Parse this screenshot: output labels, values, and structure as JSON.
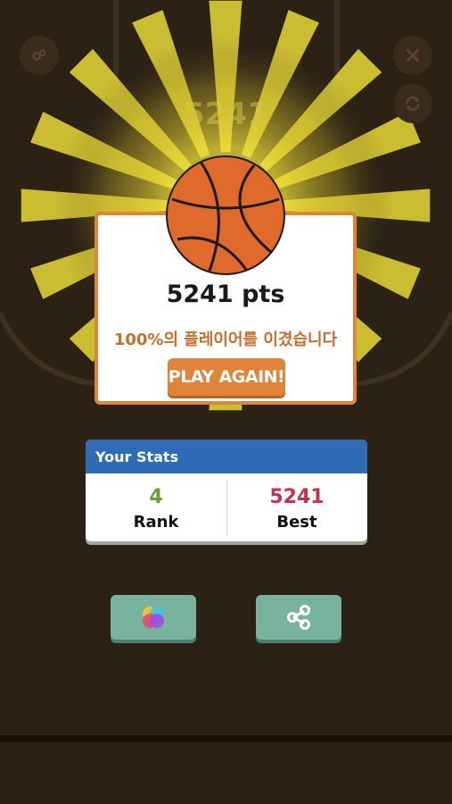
{
  "game": {
    "score_text": "5241 pts",
    "ghost_score": "5241",
    "beat_text": "100%의 플레이어를 이겼습니다",
    "play_again_label": "PLAY AGAIN!"
  },
  "stats": {
    "header": "Your Stats",
    "rank": {
      "value": "4",
      "label": "Rank",
      "color": "#6f9a34"
    },
    "best": {
      "value": "5241",
      "label": "Best",
      "color": "#c8304f"
    }
  },
  "icons": {
    "top_left": "settings-icon",
    "top_right_1": "close-icon",
    "top_right_2": "refresh-icon",
    "bottom_left": "game-center-icon",
    "bottom_right": "share-icon"
  },
  "colors": {
    "background": "#2b2115",
    "accent": "#e0843c",
    "stats_header": "#2e6db5",
    "button_green": "#78b39e",
    "glow": "#f5e93a"
  }
}
